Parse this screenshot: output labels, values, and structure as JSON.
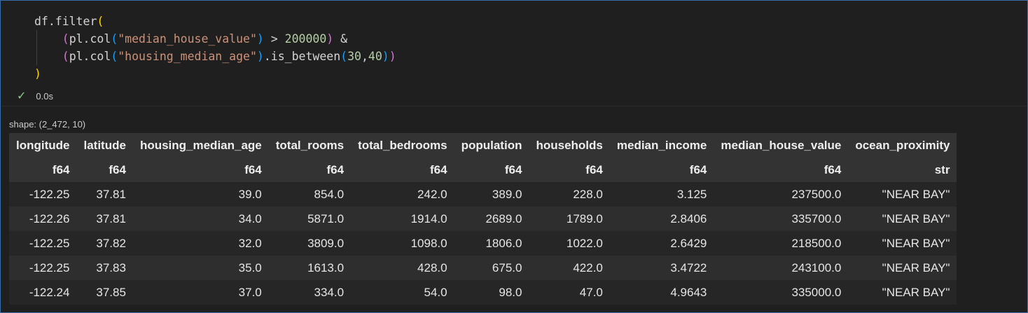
{
  "code": {
    "lines": [
      [
        {
          "t": "df.filter",
          "c": "plain"
        },
        {
          "t": "(",
          "c": "paren1"
        }
      ],
      [
        {
          "t": "    ",
          "c": "plain"
        },
        {
          "t": "(",
          "c": "paren2"
        },
        {
          "t": "pl.col",
          "c": "plain"
        },
        {
          "t": "(",
          "c": "paren3"
        },
        {
          "t": "\"median_house_value\"",
          "c": "str"
        },
        {
          "t": ")",
          "c": "paren3"
        },
        {
          "t": " > ",
          "c": "plain"
        },
        {
          "t": "200000",
          "c": "num"
        },
        {
          "t": ")",
          "c": "paren2"
        },
        {
          "t": " &",
          "c": "plain"
        }
      ],
      [
        {
          "t": "    ",
          "c": "plain"
        },
        {
          "t": "(",
          "c": "paren2"
        },
        {
          "t": "pl.col",
          "c": "plain"
        },
        {
          "t": "(",
          "c": "paren3"
        },
        {
          "t": "\"housing_median_age\"",
          "c": "str"
        },
        {
          "t": ")",
          "c": "paren3"
        },
        {
          "t": ".is_between",
          "c": "plain"
        },
        {
          "t": "(",
          "c": "paren3"
        },
        {
          "t": "30",
          "c": "num"
        },
        {
          "t": ",",
          "c": "plain"
        },
        {
          "t": "40",
          "c": "num"
        },
        {
          "t": ")",
          "c": "paren3"
        },
        {
          "t": ")",
          "c": "paren2"
        }
      ],
      [
        {
          "t": ")",
          "c": "paren1"
        }
      ]
    ]
  },
  "execution": {
    "status_icon": "check-icon",
    "time": "0.0s"
  },
  "output": {
    "shape": "shape: (2_472, 10)",
    "columns": [
      "longitude",
      "latitude",
      "housing_median_age",
      "total_rooms",
      "total_bedrooms",
      "population",
      "households",
      "median_income",
      "median_house_value",
      "ocean_proximity"
    ],
    "dtypes": [
      "f64",
      "f64",
      "f64",
      "f64",
      "f64",
      "f64",
      "f64",
      "f64",
      "f64",
      "str"
    ],
    "rows": [
      [
        "-122.25",
        "37.81",
        "39.0",
        "854.0",
        "242.0",
        "389.0",
        "228.0",
        "3.125",
        "237500.0",
        "\"NEAR BAY\""
      ],
      [
        "-122.26",
        "37.81",
        "34.0",
        "5871.0",
        "1914.0",
        "2689.0",
        "1789.0",
        "2.8406",
        "335700.0",
        "\"NEAR BAY\""
      ],
      [
        "-122.25",
        "37.82",
        "32.0",
        "3809.0",
        "1098.0",
        "1806.0",
        "1022.0",
        "2.6429",
        "218500.0",
        "\"NEAR BAY\""
      ],
      [
        "-122.25",
        "37.83",
        "35.0",
        "1613.0",
        "428.0",
        "675.0",
        "422.0",
        "3.4722",
        "243100.0",
        "\"NEAR BAY\""
      ],
      [
        "-122.24",
        "37.85",
        "37.0",
        "334.0",
        "54.0",
        "98.0",
        "47.0",
        "4.9643",
        "335000.0",
        "\"NEAR BAY\""
      ]
    ]
  }
}
